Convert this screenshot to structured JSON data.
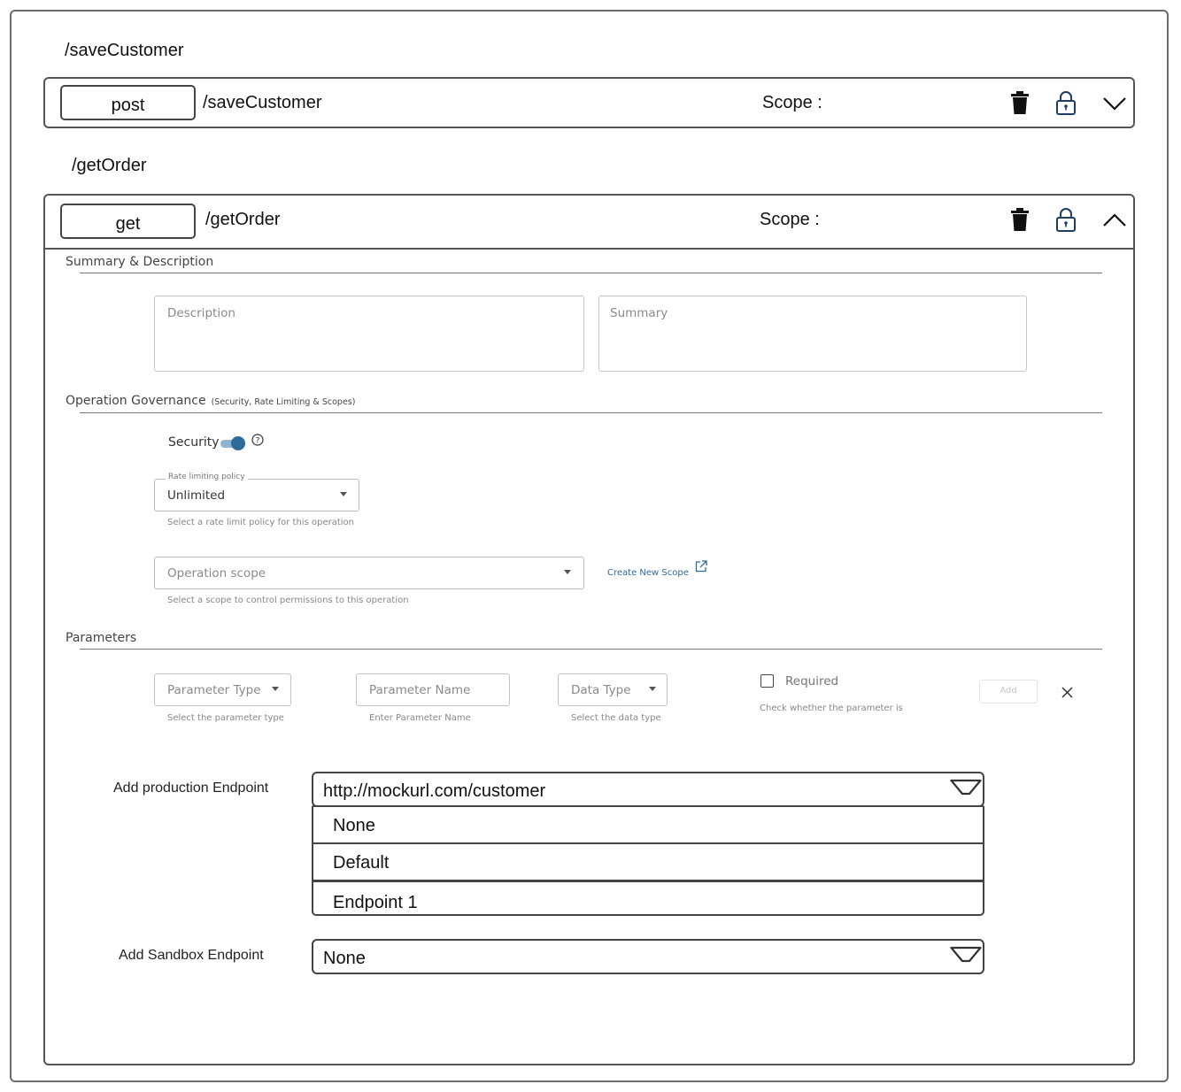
{
  "groups": [
    {
      "title": "/saveCustomer",
      "method": "post",
      "path": "/saveCustomer",
      "scope_label": "Scope :",
      "expanded": false
    },
    {
      "title": "/getOrder",
      "method": "get",
      "path": "/getOrder",
      "scope_label": "Scope :",
      "expanded": true
    }
  ],
  "icons": {
    "delete": "trash-icon",
    "lock": "lock-icon",
    "collapse": "chevron-down-icon",
    "expand": "chevron-up-icon",
    "help": "help-icon",
    "external": "external-link-icon",
    "close": "close-icon"
  },
  "summary_section": {
    "title": "Summary & Description",
    "description_placeholder": "Description",
    "summary_placeholder": "Summary"
  },
  "governance_section": {
    "title": "Operation Governance",
    "subtitle": "(Security, Rate Limiting & Scopes)",
    "security_label": "Security",
    "security_enabled": true,
    "rate_limit": {
      "label": "Rate limiting policy",
      "value": "Unlimited",
      "hint": "Select a rate limit policy for this operation"
    },
    "operation_scope": {
      "placeholder": "Operation scope",
      "hint": "Select a scope to control permissions to this operation",
      "create_link": "Create New Scope"
    }
  },
  "parameters_section": {
    "title": "Parameters",
    "parameter_type": {
      "placeholder": "Parameter Type",
      "hint": "Select the parameter type"
    },
    "parameter_name": {
      "placeholder": "Parameter Name",
      "hint": "Enter Parameter Name"
    },
    "data_type": {
      "placeholder": "Data Type",
      "hint": "Select the data type"
    },
    "required": {
      "label": "Required",
      "checked": false,
      "hint": "Check whether the parameter is"
    },
    "add_label": "Add"
  },
  "endpoints": {
    "production_label": "Add production Endpoint",
    "production_value": "http://mockurl.com/customer",
    "production_options": [
      "None",
      "Default",
      "Endpoint 1"
    ],
    "sandbox_label": "Add Sandbox Endpoint",
    "sandbox_value": "None"
  },
  "colors": {
    "border": "#555555",
    "toggle_accent": "#2f6b9a",
    "link": "#2f6b9a"
  }
}
